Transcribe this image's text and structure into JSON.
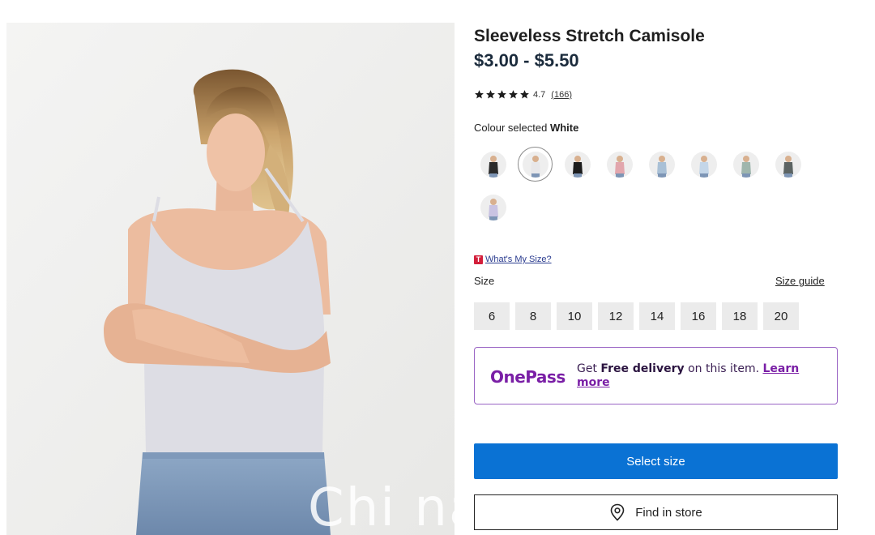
{
  "product": {
    "title": "Sleeveless Stretch Camisole",
    "price": "$3.00 - $5.50",
    "rating": "4.7",
    "review_count": "(166)",
    "stars": 5
  },
  "colour": {
    "label": "Colour selected",
    "selected": "White",
    "swatches": [
      {
        "name": "black-print",
        "color": "#2b2b2b"
      },
      {
        "name": "white",
        "color": "#e7e7ea"
      },
      {
        "name": "black",
        "color": "#1c1c1c"
      },
      {
        "name": "pink",
        "color": "#e2a6ad"
      },
      {
        "name": "light-blue",
        "color": "#a9c0d6"
      },
      {
        "name": "pale-blue",
        "color": "#c4d6e8"
      },
      {
        "name": "sage",
        "color": "#9fb6ad"
      },
      {
        "name": "charcoal",
        "color": "#5c6463"
      },
      {
        "name": "lilac",
        "color": "#c9c3e2"
      }
    ]
  },
  "size": {
    "whats_my_size_badge": "T",
    "whats_my_size": "What's My Size?",
    "label": "Size",
    "guide": "Size guide",
    "options": [
      "6",
      "8",
      "10",
      "12",
      "14",
      "16",
      "18",
      "20"
    ]
  },
  "onepass": {
    "logo": "OnePass",
    "text_before": "Get",
    "text_bold": "Free delivery",
    "text_after": "on this item.",
    "learn_more": "Learn more"
  },
  "actions": {
    "select_size": "Select size",
    "find_in_store": "Find in store"
  },
  "watermark": "Chi na",
  "colors": {
    "primary_button": "#0a72d4",
    "onepass_purple": "#7a1fa6",
    "size_chip": "#ebebeb"
  }
}
